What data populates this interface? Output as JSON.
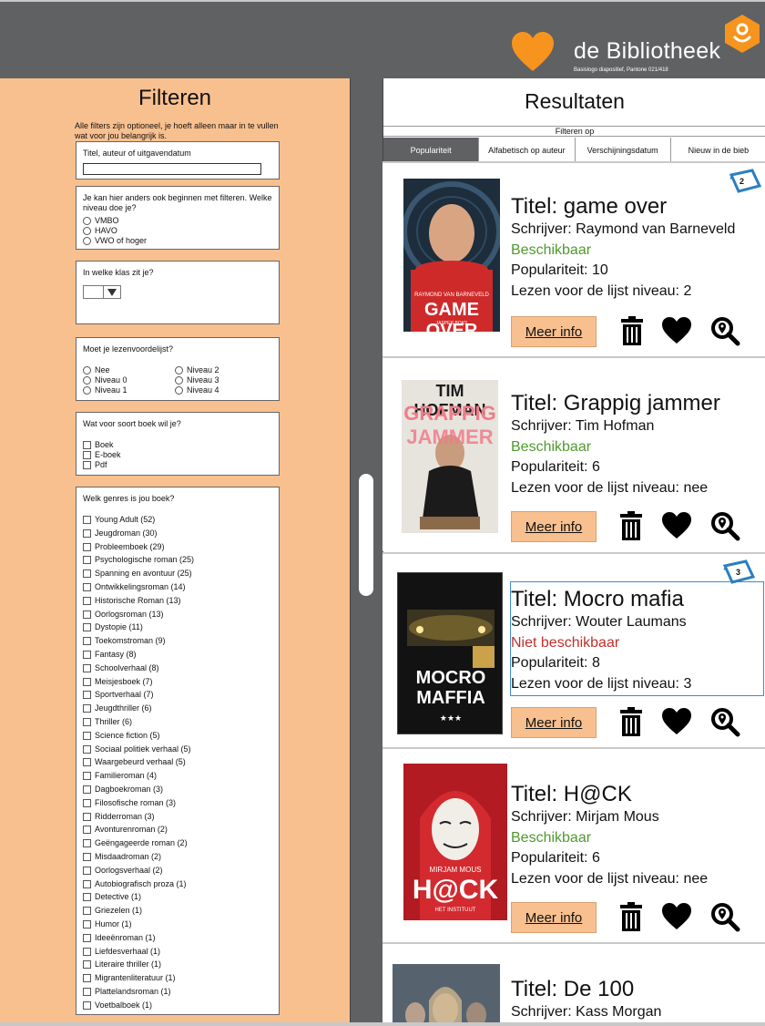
{
  "brand": {
    "name": "de Bibliotheek",
    "subtitle": "Basislogo diapositief, Pantone 021/418",
    "colors": {
      "orange": "#f7941d",
      "panel": "#f9c08f",
      "dark": "#5f6163"
    }
  },
  "filters": {
    "title": "Filteren",
    "intro": "Alle filters zijn optioneel, je hoeft alleen maar in te vullen wat voor jou belangrijk is.",
    "search": {
      "label": "Titel, auteur of uitgavendatum",
      "value": ""
    },
    "niveau": {
      "question": "Je kan hier anders ook beginnen met filteren. Welke niveau doe je?",
      "options": [
        "VMBO",
        "HAVO",
        "VWO of hoger"
      ]
    },
    "klas": {
      "question": "In welke klas zit je?",
      "value": ""
    },
    "lezenvoordelijst": {
      "question": "Moet je lezenvoordelijst?",
      "options": [
        "Nee",
        "Niveau 0",
        "Niveau 1",
        "Niveau 2",
        "Niveau 3",
        "Niveau 4"
      ]
    },
    "soort": {
      "question": "Wat voor soort boek wil je?",
      "options": [
        "Boek",
        "E-boek",
        "Pdf"
      ]
    },
    "genres": {
      "question": "Welk genres is jou boek?",
      "options": [
        "Young Adult (52)",
        "Jeugdroman (30)",
        "Probleemboek (29)",
        "Psychologische roman (25)",
        "Spanning en avontuur (25)",
        "Ontwikkelingsroman (14)",
        "Historische Roman (13)",
        "Oorlogsroman (13)",
        "Dystopie (11)",
        "Toekomstroman (9)",
        "Fantasy (8)",
        "Schoolverhaal (8)",
        "Meisjesboek (7)",
        "Sportverhaal (7)",
        "Jeugdthriller (6)",
        "Thriller (6)",
        "Science fiction (5)",
        "Sociaal politiek verhaal (5)",
        "Waargebeurd verhaal (5)",
        "Familieroman (4)",
        "Dagboekroman (3)",
        "Filosofische roman (3)",
        "Ridderroman (3)",
        "Avonturenroman (2)",
        "Geëngageerde roman (2)",
        "Misdaadroman (2)",
        "Oorlogsverhaal (2)",
        "Autobiografisch proza (1)",
        "Detective (1)",
        "Griezelen (1)",
        "Humor (1)",
        "Ideeënroman (1)",
        "Liefdesverhaal (1)",
        "Literaire thriller (1)",
        "Migrantenliteratuur (1)",
        "Plattelandsroman (1)",
        "Voetbalboek (1)"
      ]
    }
  },
  "results": {
    "title": "Resultaten",
    "filter_on": "Filteren op",
    "tabs": [
      "Populariteit",
      "Alfabetisch op auteur",
      "Verschijningsdatum",
      "Nieuw in de bieb"
    ],
    "active_tab": "Populariteit",
    "more_info": "Meer info",
    "books": [
      {
        "title": "Titel: game over",
        "author": "Schrijver: Raymond van Barneveld",
        "status": "Beschikbaar",
        "popularity": "Populariteit: 10",
        "list": "Lezen voor de lijst niveau: 2",
        "badge": "2",
        "cover": {
          "top": "RAYMOND VAN BARNEVELD",
          "title": "GAME OVER",
          "sub": "JASPER BOKS"
        }
      },
      {
        "title": "Titel: Grappig jammer",
        "author": "Schrijver: Tim Hofman",
        "status": "Beschikbaar",
        "popularity": "Populariteit: 6",
        "list": "Lezen voor de lijst niveau: nee",
        "cover": {
          "top": "TIM HOFMAN",
          "title1": "GRAPPIG",
          "title2": "JAMMER"
        }
      },
      {
        "title": "Titel: Mocro mafia",
        "author": "Schrijver: Wouter Laumans",
        "status": "Niet beschikbaar",
        "popularity": "Populariteit: 8",
        "list": "Lezen voor de lijst niveau: 3",
        "badge": "3",
        "cover": {
          "title1": "MOCRO",
          "title2": "MAFFIA",
          "stars": "★★★"
        }
      },
      {
        "title": "Titel: H@CK",
        "author": "Schrijver: Mirjam Mous",
        "status": "Beschikbaar",
        "popularity": "Populariteit: 6",
        "list": "Lezen voor de lijst niveau: nee",
        "cover": {
          "top": "MIRJAM MOUS",
          "title": "H@CK",
          "sub": "HET INSTITUUT"
        }
      },
      {
        "title": "Titel: De 100",
        "author": "Schrijver: Kass Morgan"
      }
    ]
  }
}
